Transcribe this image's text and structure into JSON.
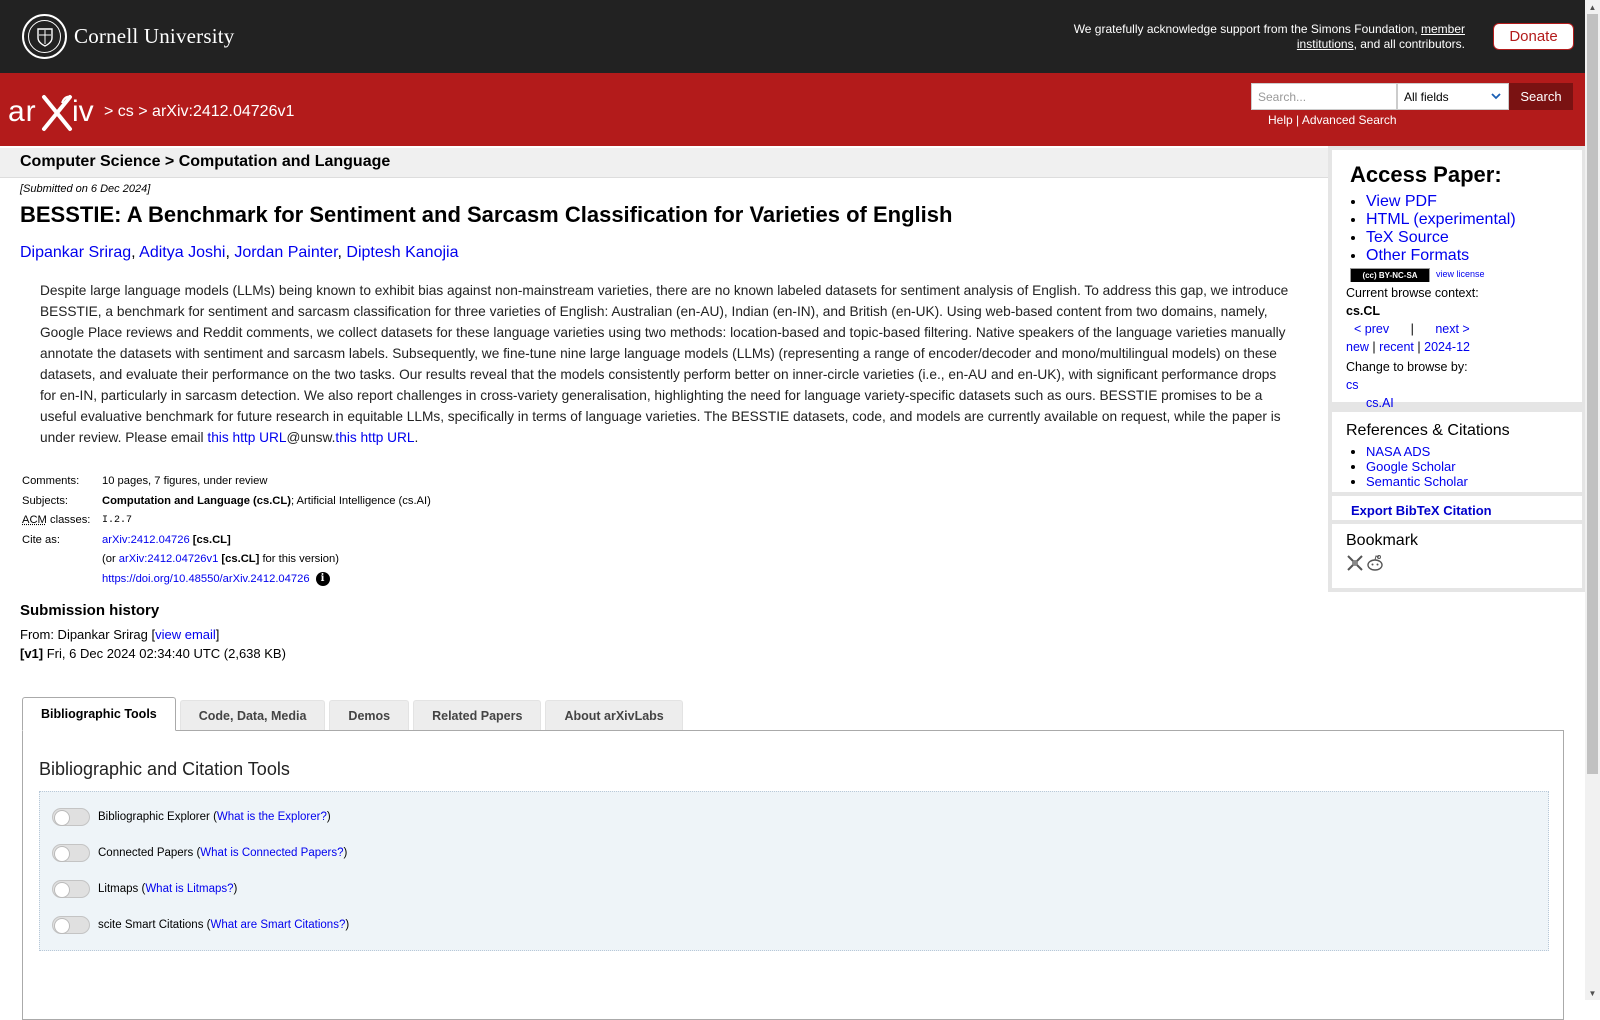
{
  "header": {
    "university": "Cornell University",
    "support_prefix": "We gratefully acknowledge support from the Simons Foundation, ",
    "support_link": "member institutions",
    "support_suffix": ", and all contributors.",
    "donate_label": "Donate"
  },
  "nav": {
    "breadcrumb_cs": "cs",
    "breadcrumb_id": "arXiv:2412.04726v1",
    "separator": ">",
    "search_placeholder": "Search...",
    "search_field": "All fields",
    "search_button": "Search",
    "help_link": "Help",
    "advanced_link": "Advanced Search"
  },
  "subject_header": "Computer Science > Computation and Language",
  "paper": {
    "submitted": "[Submitted on 6 Dec 2024]",
    "title": "BESSTIE: A Benchmark for Sentiment and Sarcasm Classification for Varieties of English",
    "authors": [
      "Dipankar Srirag",
      "Aditya Joshi",
      "Jordan Painter",
      "Diptesh Kanojia"
    ],
    "abstract_text": "Despite large language models (LLMs) being known to exhibit bias against non-mainstream varieties, there are no known labeled datasets for sentiment analysis of English. To address this gap, we introduce BESSTIE, a benchmark for sentiment and sarcasm classification for three varieties of English: Australian (en-AU), Indian (en-IN), and British (en-UK). Using web-based content from two domains, namely, Google Place reviews and Reddit comments, we collect datasets for these language varieties using two methods: location-based and topic-based filtering. Native speakers of the language varieties manually annotate the datasets with sentiment and sarcasm labels. Subsequently, we fine-tune nine large language models (LLMs) (representing a range of encoder/decoder and mono/multilingual models) on these datasets, and evaluate their performance on the two tasks. Our results reveal that the models consistently perform better on inner-circle varieties (i.e., en-AU and en-UK), with significant performance drops for en-IN, particularly in sarcasm detection. We also report challenges in cross-variety generalisation, highlighting the need for language variety-specific datasets such as ours. BESSTIE promises to be a useful evaluative benchmark for future research in equitable LLMs, specifically in terms of language varieties. The BESSTIE datasets, code, and models are currently available on request, while the paper is under review. Please email ",
    "abstract_link1": "this http URL",
    "abstract_mid": "@unsw.",
    "abstract_link2": "this http URL",
    "abstract_end": "."
  },
  "meta": {
    "comments_label": "Comments:",
    "comments": "10 pages, 7 figures, under review",
    "subjects_label": "Subjects:",
    "subjects_primary": "Computation and Language (cs.CL)",
    "subjects_secondary": "; Artificial Intelligence (cs.AI)",
    "acm_abbr": "ACM",
    "acm_label": " classes:",
    "acm_value": "I.2.7",
    "cite_label": "Cite as:",
    "cite_id": "arXiv:2412.04726",
    "cite_cat": " [cs.CL]",
    "cite_version_prefix": "(or ",
    "cite_version_id": "arXiv:2412.04726v1",
    "cite_version_cat": " [cs.CL]",
    "cite_version_suffix": " for this version)",
    "doi": "https://doi.org/10.48550/arXiv.2412.04726",
    "info_glyph": "i"
  },
  "history": {
    "title": "Submission history",
    "from_prefix": "From: Dipankar Srirag [",
    "view_email": "view email",
    "from_suffix": "]",
    "v1_label": "[v1]",
    "v1_text": " Fri, 6 Dec 2024 02:34:40 UTC (2,638 KB)"
  },
  "tabs": [
    {
      "label": "Bibliographic Tools",
      "active": true
    },
    {
      "label": "Code, Data, Media",
      "active": false
    },
    {
      "label": "Demos",
      "active": false
    },
    {
      "label": "Related Papers",
      "active": false
    },
    {
      "label": "About arXivLabs",
      "active": false
    }
  ],
  "tools_panel": {
    "title": "Bibliographic and Citation Tools",
    "items": [
      {
        "name": "Bibliographic Explorer",
        "link": "What is the Explorer?"
      },
      {
        "name": "Connected Papers",
        "link": "What is Connected Papers?"
      },
      {
        "name": "Litmaps",
        "link": "What is Litmaps?"
      },
      {
        "name": "scite Smart Citations",
        "link": "What are Smart Citations?"
      }
    ]
  },
  "sidebar": {
    "access_title": "Access Paper:",
    "access_links": [
      "View PDF",
      "HTML (experimental)",
      "TeX Source",
      "Other Formats"
    ],
    "cc_badge": "(cc) BY-NC-SA",
    "view_license": "view license",
    "browse_context_label": "Current browse context:",
    "browse_context": "cs.CL",
    "prev": "< prev",
    "pipe": "|",
    "next": "next >",
    "new": "new",
    "recent": "recent",
    "month": "2024-12",
    "change_browse_label": "Change to browse by:",
    "browse_cs": "cs",
    "browse_csai": "cs.AI",
    "refs_title": "References & Citations",
    "refs_links": [
      "NASA ADS",
      "Google Scholar",
      "Semantic Scholar"
    ],
    "export_bibtex": "Export BibTeX Citation",
    "bookmark_title": "Bookmark"
  },
  "colors": {
    "arxiv_red": "#b31b1b",
    "top_black": "#222222",
    "link_blue": "#0000ee"
  }
}
